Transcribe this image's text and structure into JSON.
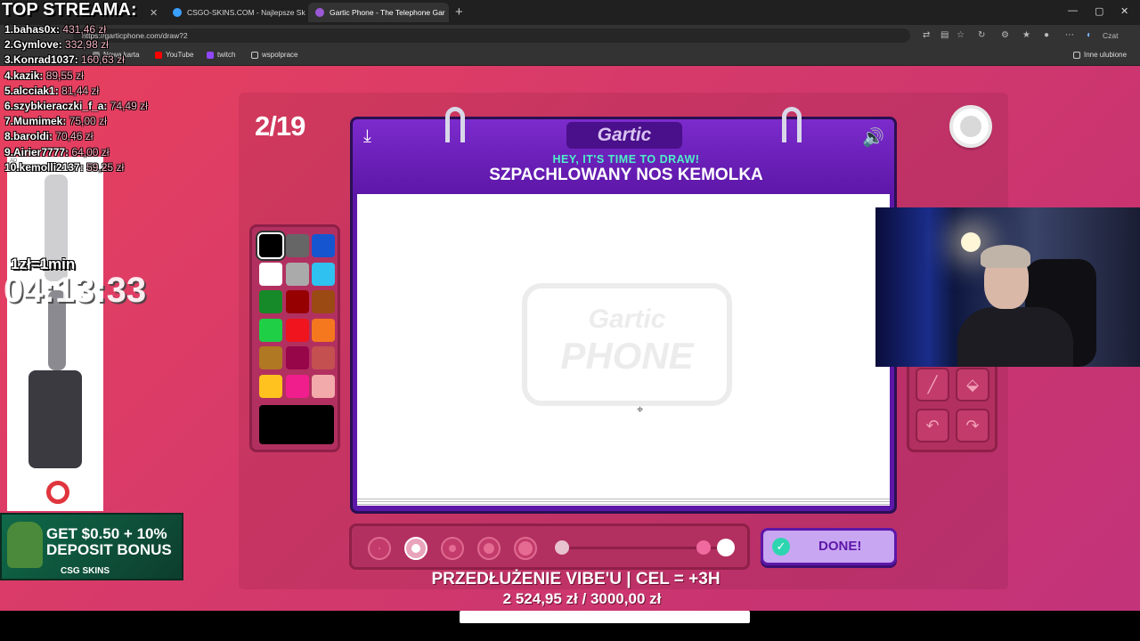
{
  "browser": {
    "tabs": [
      {
        "label": "CSGO-SKINS.COM - Najlepsze Sk",
        "close": "✕"
      },
      {
        "label": "Gartic Phone - The Telephone Gar",
        "close": "✕"
      }
    ],
    "first_tab_close": "✕",
    "new_tab": "+",
    "url": "https://garticphone.com/draw?2",
    "bookmarks": [
      "Nowa karta",
      "YouTube",
      "twitch",
      "wspolprace"
    ],
    "favorites_label": "Inne ulubione",
    "copilot_label": "Czat",
    "window_controls": [
      "—",
      "▢",
      "✕"
    ]
  },
  "stream": {
    "title": "TOP STREAMA:",
    "donors": [
      {
        "name": "1.bahas0x:",
        "amount": "431,46 zł"
      },
      {
        "name": "2.Gymlove:",
        "amount": "332,98 zł"
      },
      {
        "name": "3.Konrad1037:",
        "amount": "160,63 zł"
      },
      {
        "name": "4.kazik:",
        "amount": "89,55 zł"
      },
      {
        "name": "5.alcciak1:",
        "amount": "81,44 zł"
      },
      {
        "name": "6.szybkieraczki_f_a:",
        "amount": "74,49 zł"
      },
      {
        "name": "7.Mumimek:",
        "amount": "75,00 zł"
      },
      {
        "name": "8.baroldi:",
        "amount": "70,46 zł"
      },
      {
        "name": "9.Airier7777:",
        "amount": "64,00 zł"
      },
      {
        "name": "10.kemolli2137:",
        "amount": "59,25 zł"
      }
    ],
    "ad_tag": "AD",
    "rate": "1zł=1min",
    "countdown": "04:13:33",
    "banner": {
      "line1": "GET $0.50 + 10%",
      "line2": "DEPOSIT BONUS",
      "brand": "CSG SKINS"
    },
    "goal_title": "PRZEDŁUŻENIE VIBE'U | CEL = +3H",
    "goal_value": "2 524,95 zł  /  3000,00 zł"
  },
  "game": {
    "round": "2/19",
    "logo": "Gartic",
    "prompt_hint": "HEY, IT'S TIME TO DRAW!",
    "prompt": "SZPACHLOWANY NOS KEMOLKA",
    "watermark_top": "Gartic",
    "watermark_bottom": "PHONE",
    "done_label": "DONE!",
    "palette": [
      "#000000",
      "#666666",
      "#1556d0",
      "#ffffff",
      "#aaaaaa",
      "#2fc1f0",
      "#168a28",
      "#960000",
      "#9a4a12",
      "#1fd046",
      "#f0141e",
      "#f5781e",
      "#b07822",
      "#98064a",
      "#c45050",
      "#ffc21e",
      "#f01e8c",
      "#f3aaaa"
    ],
    "current_color": "#000000",
    "icons": {
      "download": "⤓",
      "sound": "🔊",
      "done": "✓",
      "crosshair": "⌖",
      "tools": [
        "╱",
        "⬙",
        "↶",
        "↷"
      ]
    }
  }
}
